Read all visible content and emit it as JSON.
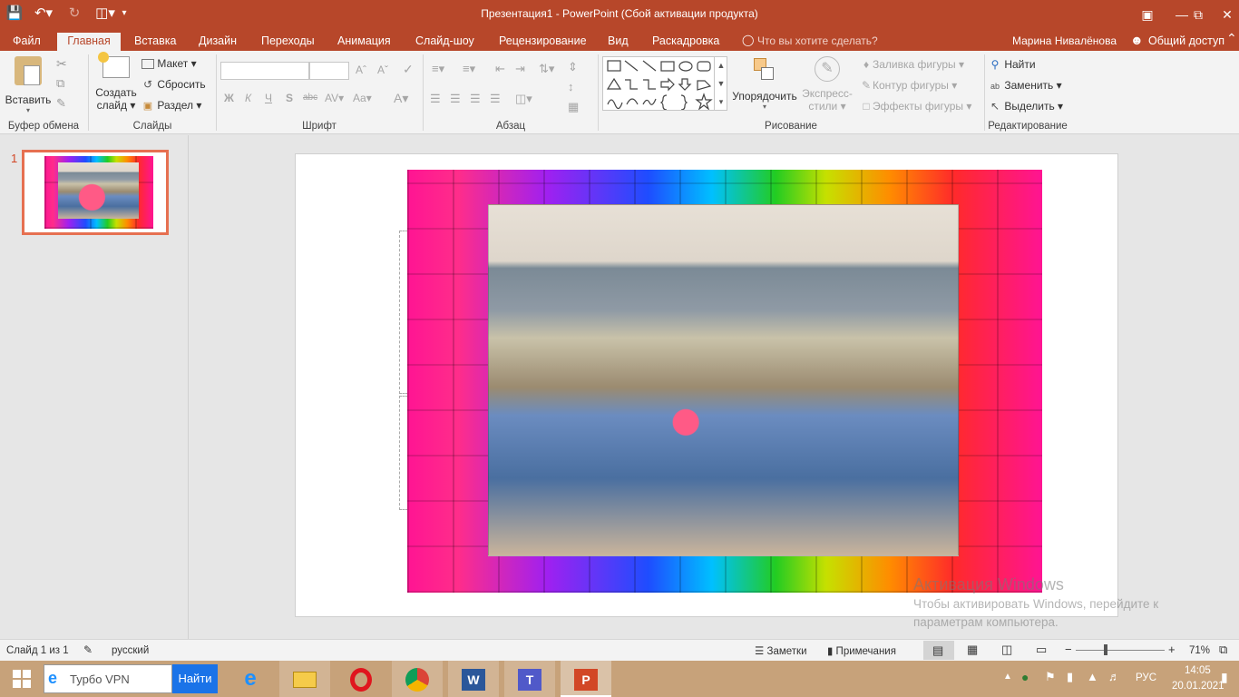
{
  "titlebar": {
    "title": "Презентация1 - PowerPoint (Сбой активации продукта)",
    "qat_icons": [
      "save-icon",
      "undo-icon",
      "redo-icon",
      "present-icon",
      "customize-icon"
    ],
    "window_buttons": [
      "ribbon-display-icon",
      "minimize-icon",
      "restore-icon",
      "close-icon"
    ]
  },
  "tabs": [
    {
      "label": "Файл"
    },
    {
      "label": "Главная"
    },
    {
      "label": "Вставка"
    },
    {
      "label": "Дизайн"
    },
    {
      "label": "Переходы"
    },
    {
      "label": "Анимация"
    },
    {
      "label": "Слайд-шоу"
    },
    {
      "label": "Рецензирование"
    },
    {
      "label": "Вид"
    },
    {
      "label": "Раскадровка"
    }
  ],
  "tell_me": "Что вы хотите сделать?",
  "user_name": "Марина Нивалёнова",
  "share_label": "Общий доступ",
  "ribbon": {
    "clipboard": {
      "paste": "Вставить",
      "label": "Буфер обмена"
    },
    "slides": {
      "new_slide_line1": "Создать",
      "new_slide_line2": "слайд",
      "layout": "Макет",
      "reset": "Сбросить",
      "section": "Раздел",
      "label": "Слайды"
    },
    "font": {
      "label": "Шрифт",
      "bold": "Ж",
      "italic": "К",
      "underline": "Ч",
      "shadow": "S",
      "strike": "abc",
      "spacing": "AV",
      "case": "Aa",
      "color": "A"
    },
    "paragraph": {
      "label": "Абзац"
    },
    "drawing": {
      "arrange": "Упорядочить",
      "quick_styles_line1": "Экспресс-",
      "quick_styles_line2": "стили",
      "fill": "Заливка фигуры",
      "outline": "Контур фигуры",
      "effects": "Эффекты фигуры",
      "label": "Рисование"
    },
    "editing": {
      "find": "Найти",
      "replace": "Заменить",
      "select": "Выделить",
      "label": "Редактирование"
    }
  },
  "thumbnail": {
    "number": "1"
  },
  "watermark": {
    "title": "Активация Windows",
    "line1": "Чтобы активировать Windows, перейдите к",
    "line2": "параметрам компьютера."
  },
  "status": {
    "slide": "Слайд 1 из 1",
    "language": "русский",
    "notes": "Заметки",
    "comments": "Примечания",
    "zoom": "71%",
    "zoom_fraction": 0.71
  },
  "taskbar": {
    "search_placeholder": "Турбо VPN",
    "search_button": "Найти",
    "lang": "РУС",
    "time": "14:05",
    "date": "20.01.2021",
    "apps": [
      "internet-explorer-icon",
      "file-explorer-icon",
      "opera-icon",
      "chrome-icon",
      "word-icon",
      "teams-icon",
      "powerpoint-icon"
    ]
  },
  "colors": {
    "accent": "#b7472a",
    "ribbon_bg": "#f3f3f3",
    "taskbar_bg": "#c7a27a"
  }
}
